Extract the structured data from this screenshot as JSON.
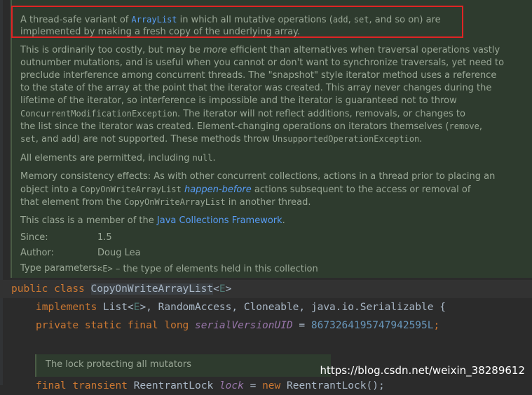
{
  "doc": {
    "p1": {
      "t1": "A thread-safe variant of ",
      "link_arraylist": "ArrayList",
      "t2": " in which all mutative operations (",
      "code_add": "add",
      "t3": ", ",
      "code_set": "set",
      "t4": ", and so on) are",
      "line2": "implemented by making a fresh copy of the underlying array."
    },
    "p2": {
      "l1a": "This is ordinarily too costly, but may be ",
      "l1_more": "more",
      "l1b": " efficient than alternatives when traversal operations vastly",
      "l2": "outnumber mutations, and is useful when you cannot or don't want to synchronize traversals, yet need to",
      "l3": "preclude interference among concurrent threads. The \"snapshot\" style iterator method uses a reference",
      "l4": "to the state of the array at the point that the iterator was created. This array never changes during the",
      "l5": "lifetime of the iterator, so interference is impossible and the iterator is guaranteed not to throw",
      "l6_code": "ConcurrentModificationException",
      "l6b": ". The iterator will not reflect additions, removals, or changes to",
      "l7a": "the list since the iterator was created. Element-changing operations on iterators themselves (",
      "l7_code": "remove",
      "l7b": ",",
      "l8_code_set": "set",
      "l8a": ", and ",
      "l8_code_add": "add",
      "l8b": ") are not supported. These methods throw ",
      "l8_code_ex": "UnsupportedOperationException",
      "l8c": "."
    },
    "p3": {
      "a": "All elements are permitted, including ",
      "code_null": "null",
      "b": "."
    },
    "p4": {
      "l1": "Memory consistency effects: As with other concurrent collections, actions in a thread prior to placing an",
      "l2a": "object into a ",
      "l2_code": "CopyOnWriteArrayList",
      "l2_hb": "happen-before",
      "l2b": " actions subsequent to the access or removal of",
      "l3a": "that element from the ",
      "l3_code": "CopyOnWriteArrayList",
      "l3b": " in another thread."
    },
    "p5": {
      "a": "This class is a member of the ",
      "link": "Java Collections Framework",
      "b": "."
    },
    "tags": {
      "since_label": "Since:",
      "since_value": "1.5",
      "author_label": "Author:",
      "author_value": "Doug Lea",
      "typeparams_label": "Type parameters:",
      "typeparams_code": "<E>",
      "typeparams_value": " – the type of elements held in this collection"
    }
  },
  "code": {
    "line1": {
      "kw_public": "public",
      "kw_class": "class",
      "class_name": "CopyOnWriteArrayList",
      "lt": "<",
      "type_param": "E",
      "gt": ">"
    },
    "line2": {
      "kw_implements": "implements",
      "list": "List<",
      "type_param": "E",
      "rest": ">, RandomAccess, Cloneable, java.io.Serializable {"
    },
    "line3": {
      "kw_private": "private",
      "kw_static": "static",
      "kw_final": "final",
      "kw_long": "long",
      "field": "serialVersionUID",
      "eq": " = ",
      "value": "8673264195747942595L",
      "semi": ";"
    },
    "line4": {
      "kw_final": "final",
      "kw_transient": "transient",
      "type": "ReentrantLock",
      "field": "lock",
      "eq": " = ",
      "kw_new": "new",
      "ctor": "ReentrantLock();"
    }
  },
  "lock_doc": "The lock protecting all mutators",
  "watermark": "https://blog.csdn.net/weixin_38289612",
  "colors": {
    "editor_bg": "#2b2b2b",
    "doc_bg": "#2e3b2e",
    "doc_text": "#9aa796",
    "link": "#589df6",
    "keyword": "#cc7832",
    "field": "#9876aa",
    "number": "#6897bb",
    "highlight_box": "#e02424"
  }
}
